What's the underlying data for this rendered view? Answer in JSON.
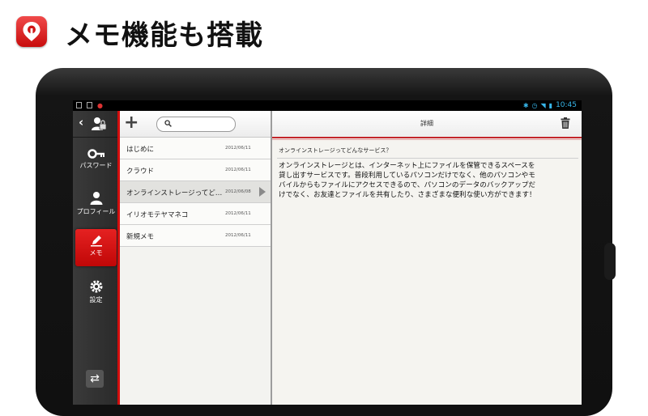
{
  "banner": {
    "title": "メモ機能も搭載",
    "logo_icon": "location-pin-icon"
  },
  "status_bar": {
    "time": "10:45"
  },
  "sidebar": {
    "items": [
      {
        "label": "パスワード",
        "icon": "key-icon"
      },
      {
        "label": "プロフィール",
        "icon": "person-icon"
      },
      {
        "label": "メモ",
        "icon": "pencil-icon",
        "active": true
      },
      {
        "label": "設定",
        "icon": "gear-icon"
      }
    ]
  },
  "memo_list": {
    "search_value": "",
    "items": [
      {
        "title": "はじめに",
        "date": "2012/06/11"
      },
      {
        "title": "クラウド",
        "date": "2012/06/11"
      },
      {
        "title": "オンラインストレージってど…",
        "date": "2012/06/08",
        "selected": true
      },
      {
        "title": "イリオモテヤマネコ",
        "date": "2012/06/11"
      },
      {
        "title": "新規メモ",
        "date": "2012/06/11"
      }
    ]
  },
  "detail": {
    "title": "詳細",
    "subject": "オンラインストレージってどんなサービス？",
    "body": "オンラインストレージとは、インターネット上にファイルを保管できるスペースを\n貸し出すサービスです。普段利用しているパソコンだけでなく、他のパソコンやモ\nバイルからもファイルにアクセスできるので、パソコンのデータのバックアップだ\nけでなく、お友達とファイルを共有したり、さまざまな便利な使い方ができます！"
  },
  "colors": {
    "accent": "#d20d0d"
  }
}
